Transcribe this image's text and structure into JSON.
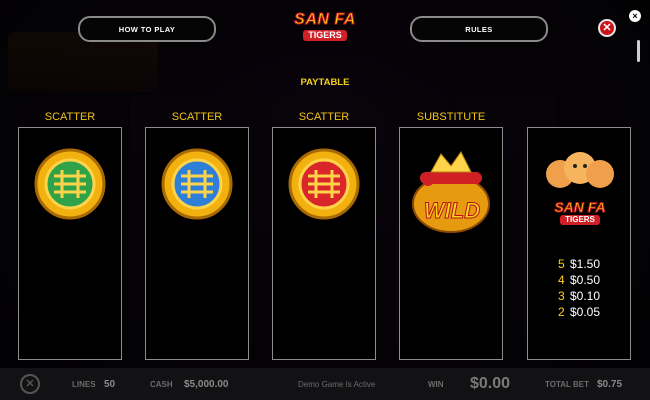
{
  "header": {
    "how_to_play": "HOW TO PLAY",
    "rules": "RULES",
    "brand_line1": "SAN FA",
    "brand_line2": "TIGERS",
    "close_glyph": "✕",
    "small_close_glyph": "×"
  },
  "paytable": {
    "title": "PAYTABLE",
    "symbols": [
      {
        "label": "SCATTER",
        "icon": "green-coin-icon",
        "color": "#2fa34a"
      },
      {
        "label": "SCATTER",
        "icon": "blue-coin-icon",
        "color": "#2f7fd8"
      },
      {
        "label": "SCATTER",
        "icon": "red-coin-icon",
        "color": "#d8262b"
      },
      {
        "label": "SUBSTITUTE",
        "icon": "wild-pot-icon",
        "wild_text": "WILD"
      },
      {
        "label": "",
        "icon": "tigers-logo-icon",
        "logo_line1": "SAN FA",
        "logo_line2": "TIGERS",
        "payouts": [
          {
            "count": "5",
            "amount": "$1.50"
          },
          {
            "count": "4",
            "amount": "$0.50"
          },
          {
            "count": "3",
            "amount": "$0.10"
          },
          {
            "count": "2",
            "amount": "$0.05"
          }
        ]
      }
    ]
  },
  "bottom_bar": {
    "lines_label": "LINES",
    "lines_value": "50",
    "cash_label": "CASH",
    "cash_value": "$5,000.00",
    "demo_text": "Demo Game Is Active",
    "win_label": "WIN",
    "win_value": "$0.00",
    "total_bet_label": "TOTAL BET",
    "total_bet_value": "$0.75"
  },
  "colors": {
    "accent_gold": "#f2c414",
    "close_red": "#c9131b"
  }
}
